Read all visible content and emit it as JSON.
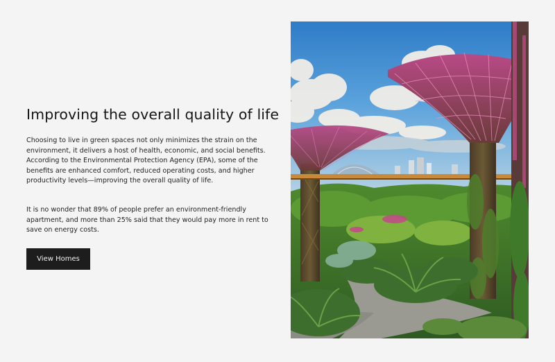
{
  "content": {
    "heading": "Improving the overall quality of life",
    "paragraph_1": "Choosing to live in green spaces not only minimizes the strain on the environment, it delivers a host of health, economic, and social benefits. According to the Environmental Protection Agency (EPA), some of the benefits are enhanced comfort, reduced operating costs, and higher productivity levels—improving the overall quality of life.",
    "paragraph_2": "It is no wonder that 89% of people prefer an environment-friendly apartment, and more than 25% said that they would pay more in rent to save on energy costs.",
    "button_label": "View Homes"
  },
  "image": {
    "subject": "supertree-garden-photo"
  },
  "colors": {
    "background": "#f4f4f5",
    "button": "#1d1d1d",
    "button_text": "#f2f2f2",
    "heading": "#161616"
  }
}
